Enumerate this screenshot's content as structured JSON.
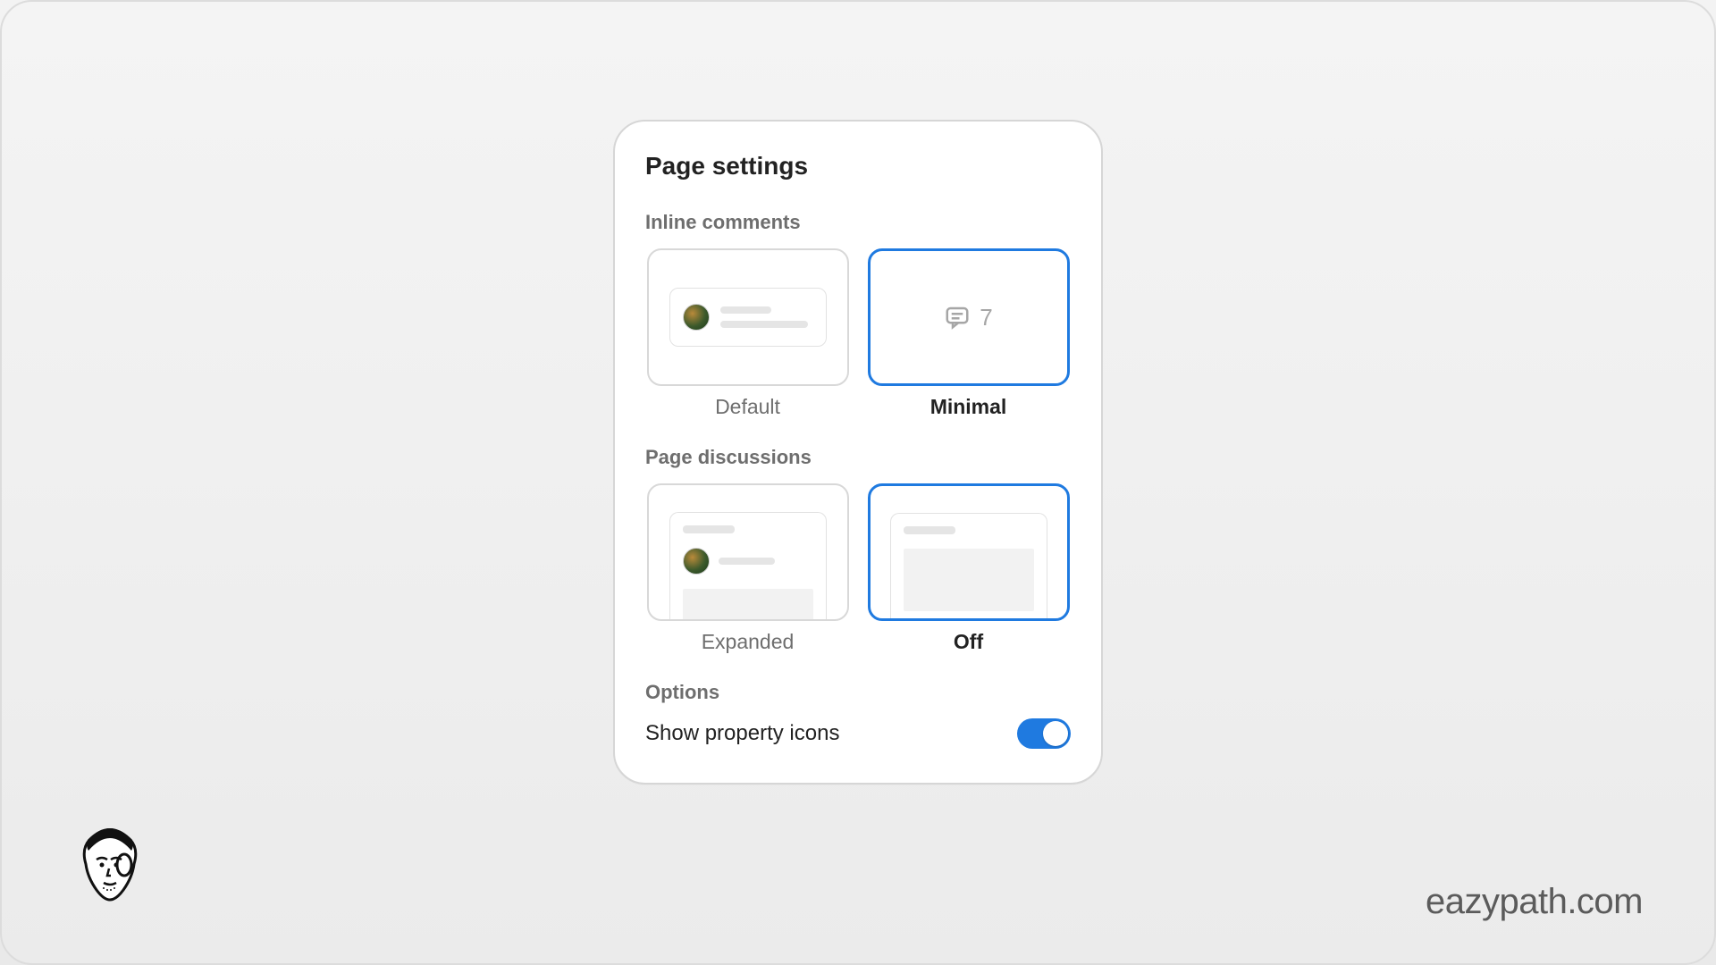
{
  "card": {
    "title": "Page settings",
    "inline_comments": {
      "label": "Inline comments",
      "default_label": "Default",
      "minimal_label": "Minimal",
      "minimal_count": "7",
      "selected": "minimal"
    },
    "page_discussions": {
      "label": "Page discussions",
      "expanded_label": "Expanded",
      "off_label": "Off",
      "selected": "off"
    },
    "options": {
      "label": "Options",
      "show_property_icons_label": "Show property icons",
      "show_property_icons_enabled": true
    }
  },
  "watermark": "eazypath.com"
}
